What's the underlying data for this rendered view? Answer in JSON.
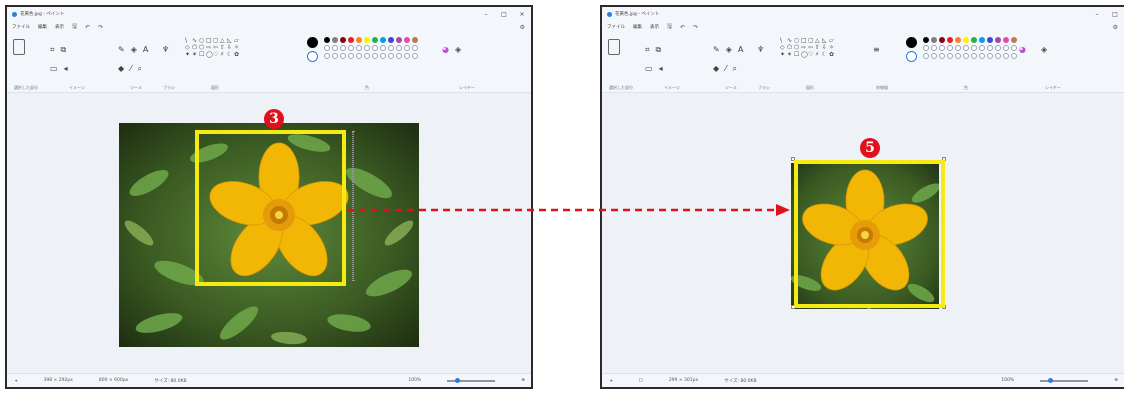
{
  "left_window": {
    "title": "花黄色.jpg - ペイント",
    "menu": [
      "ファイル",
      "編集",
      "表示"
    ],
    "ribbon_groups": {
      "select": "選択した部分",
      "image": "イメージ",
      "tools": "ツール",
      "brush": "ブラシ",
      "shapes": "図形",
      "colors": "色",
      "layers": "レイヤー"
    },
    "status": {
      "canvas_size": "398 × 292px",
      "selection_size": "800 × 600px",
      "file_size": "サイズ: 80.0KB",
      "zoom": "100%"
    },
    "step_badge": "3"
  },
  "right_window": {
    "title": "花黄色.jpg - ペイント",
    "menu": [
      "ファイル",
      "編集",
      "表示"
    ],
    "ribbon_groups": {
      "select": "選択した部分",
      "image": "イメージ",
      "tools": "ツール",
      "brush": "ブラシ",
      "shapes": "図形",
      "stroke": "枠線幅",
      "colors": "色",
      "layers": "レイヤー"
    },
    "status": {
      "canvas_size": "299 × 301px",
      "file_size": "サイズ: 80.0KB",
      "zoom": "100%"
    },
    "step_badge": "5"
  },
  "colors": {
    "highlight": "#f5ea12",
    "badge": "#e1101a",
    "arrow": "#e1101a",
    "palette": [
      "#000000",
      "#7f7f7f",
      "#880015",
      "#ed1c24",
      "#ff7f27",
      "#fff200",
      "#22b14c",
      "#00a2e8",
      "#3f48cc",
      "#a349a4",
      "#e84aa9",
      "#b97a57"
    ]
  },
  "icons": [
    "settings-gear-icon",
    "save-icon",
    "undo-icon",
    "redo-icon",
    "pencil-icon",
    "fill-icon",
    "text-icon",
    "eraser-icon",
    "color-picker-icon",
    "magnifier-icon",
    "brush-icon",
    "layers-icon",
    "color-wheel-icon"
  ]
}
